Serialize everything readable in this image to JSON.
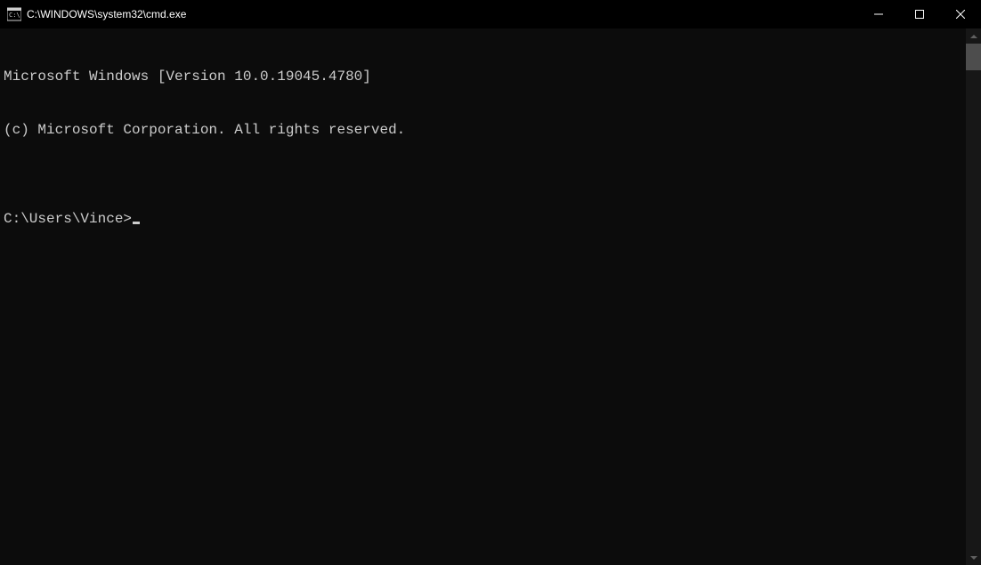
{
  "titlebar": {
    "title": "C:\\WINDOWS\\system32\\cmd.exe"
  },
  "terminal": {
    "line1": "Microsoft Windows [Version 10.0.19045.4780]",
    "line2": "(c) Microsoft Corporation. All rights reserved.",
    "blank": "",
    "prompt": "C:\\Users\\Vince>"
  }
}
